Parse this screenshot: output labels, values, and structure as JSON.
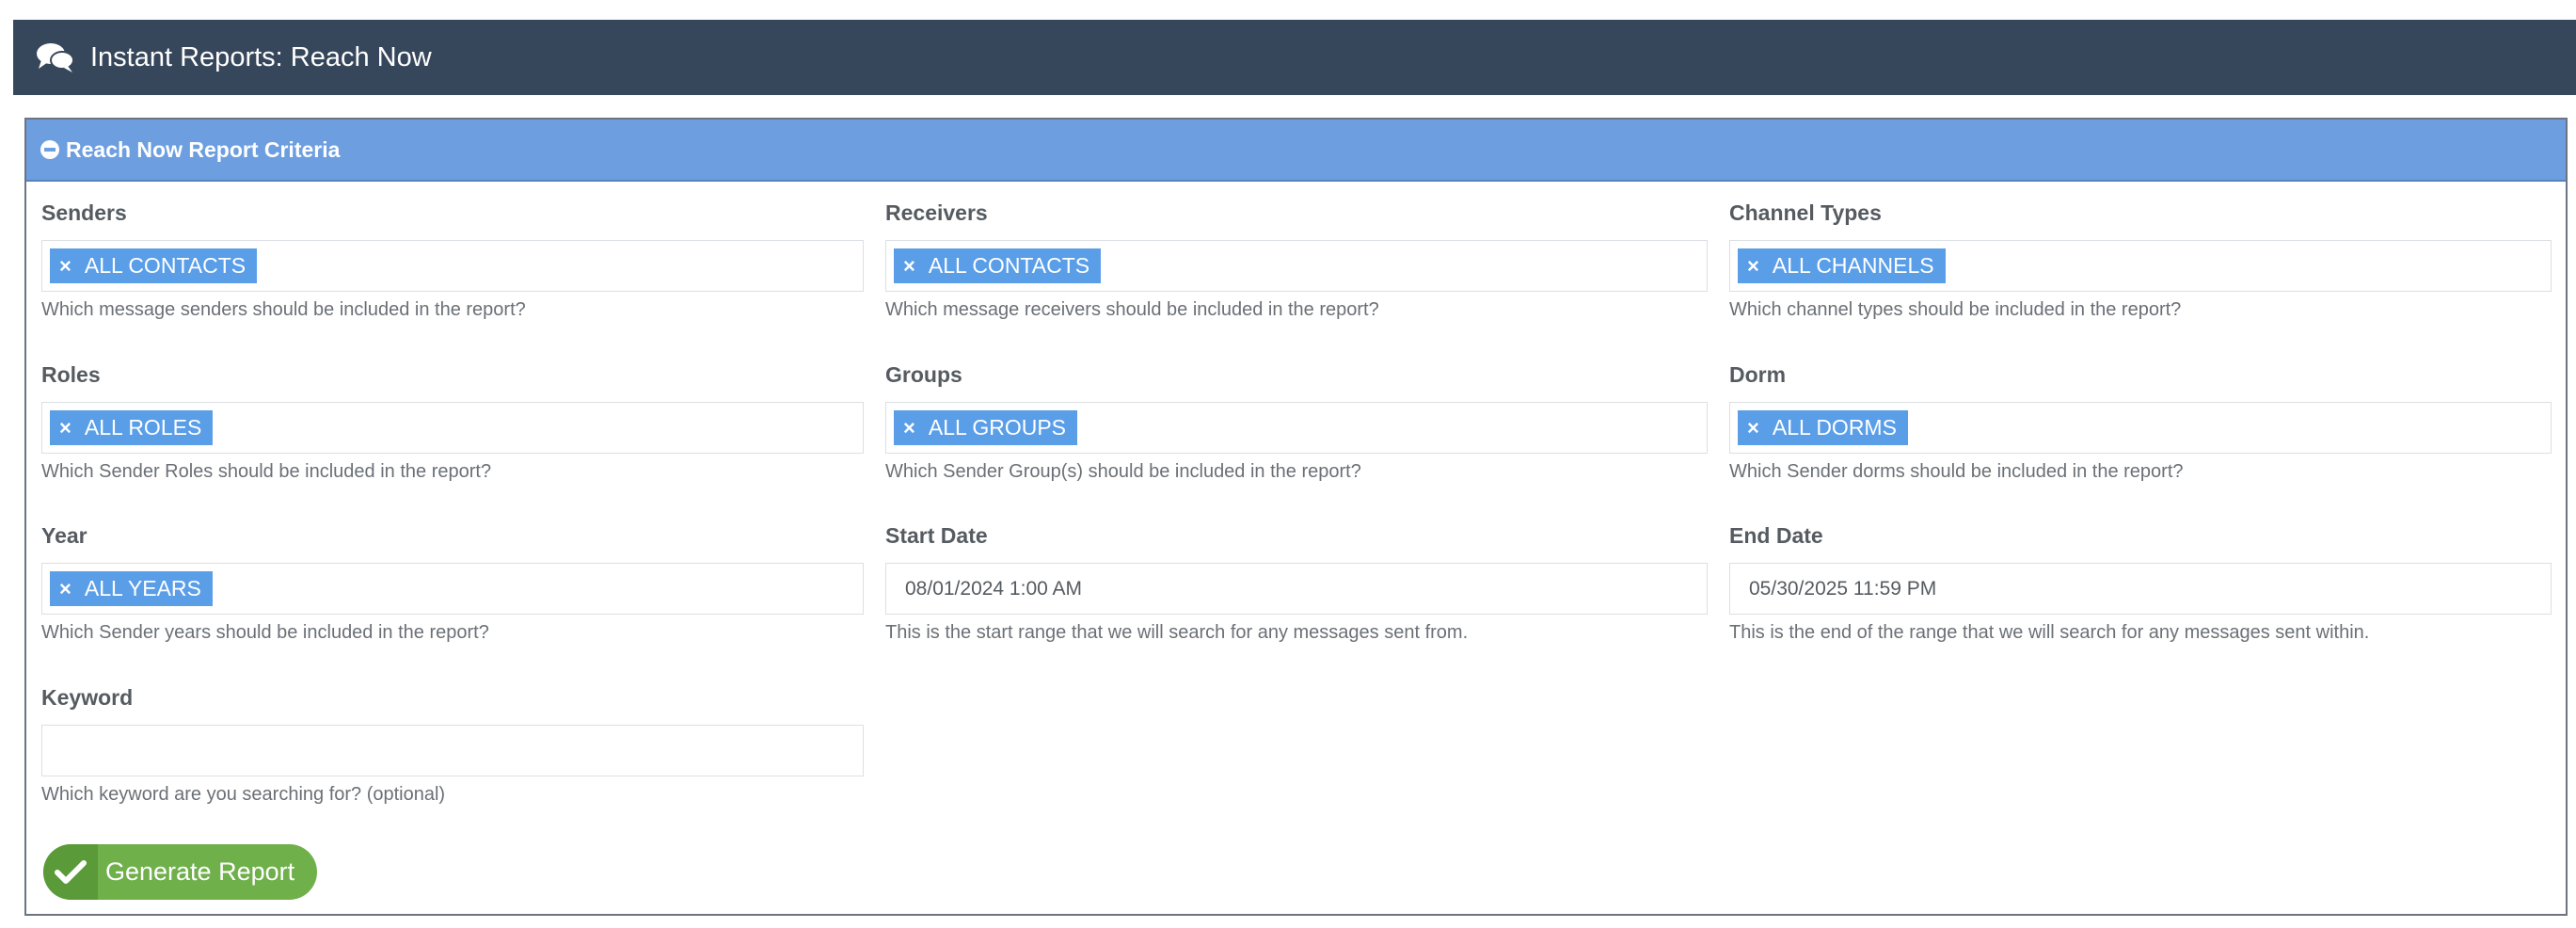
{
  "header": {
    "title": "Instant Reports: Reach Now",
    "icon": "comments-icon"
  },
  "panel": {
    "heading": "Reach Now Report Criteria",
    "heading_icon": "minus-circle-icon"
  },
  "fields": {
    "senders": {
      "label": "Senders",
      "tag": "ALL CONTACTS",
      "help": "Which message senders should be included in the report?"
    },
    "receivers": {
      "label": "Receivers",
      "tag": "ALL CONTACTS",
      "help": "Which message receivers should be included in the report?"
    },
    "channel_types": {
      "label": "Channel Types",
      "tag": "ALL CHANNELS",
      "help": "Which channel types should be included in the report?"
    },
    "roles": {
      "label": "Roles",
      "tag": "ALL ROLES",
      "help": "Which Sender Roles should be included in the report?"
    },
    "groups": {
      "label": "Groups",
      "tag": "ALL GROUPS",
      "help": "Which Sender Group(s) should be included in the report?"
    },
    "dorm": {
      "label": "Dorm",
      "tag": "ALL DORMS",
      "help": "Which Sender dorms should be included in the report?"
    },
    "year": {
      "label": "Year",
      "tag": "ALL YEARS",
      "help": "Which Sender years should be included in the report?"
    },
    "start_date": {
      "label": "Start Date",
      "value": "08/01/2024 1:00 AM",
      "help": "This is the start range that we will search for any messages sent from."
    },
    "end_date": {
      "label": "End Date",
      "value": "05/30/2025 11:59 PM",
      "help": "This is the end of the range that we will search for any messages sent within."
    },
    "keyword": {
      "label": "Keyword",
      "value": "",
      "help": "Which keyword are you searching for? (optional)"
    }
  },
  "tag_remove_symbol": "×",
  "generate_button": {
    "label": "Generate Report",
    "icon": "check-icon"
  },
  "colors": {
    "header_bg": "#37475b",
    "panel_heading_bg": "#6c9ee0",
    "tag_bg": "#5b9ee8",
    "button_bg": "#6fb04b"
  }
}
